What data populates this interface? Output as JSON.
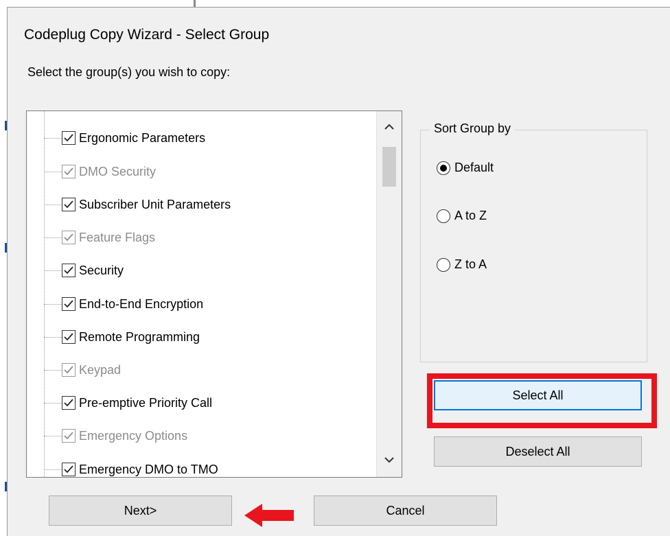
{
  "window": {
    "title": "Codeplug Copy Wizard - Select Group",
    "instruction": "Select the group(s) you wish to copy:"
  },
  "groups": [
    {
      "label": "Ergonomic Parameters",
      "checked": true,
      "enabled": true
    },
    {
      "label": "DMO Security",
      "checked": true,
      "enabled": false
    },
    {
      "label": "Subscriber Unit Parameters",
      "checked": true,
      "enabled": true
    },
    {
      "label": "Feature Flags",
      "checked": true,
      "enabled": false
    },
    {
      "label": "Security",
      "checked": true,
      "enabled": true
    },
    {
      "label": "End-to-End Encryption",
      "checked": true,
      "enabled": true
    },
    {
      "label": "Remote Programming",
      "checked": true,
      "enabled": true
    },
    {
      "label": "Keypad",
      "checked": true,
      "enabled": false
    },
    {
      "label": "Pre-emptive Priority Call",
      "checked": true,
      "enabled": true
    },
    {
      "label": "Emergency Options",
      "checked": true,
      "enabled": false
    },
    {
      "label": "Emergency DMO to TMO",
      "checked": true,
      "enabled": true
    }
  ],
  "sort": {
    "legend": "Sort Group by",
    "options": [
      {
        "label": "Default",
        "selected": true
      },
      {
        "label": "A to Z",
        "selected": false
      },
      {
        "label": "Z to A",
        "selected": false
      }
    ]
  },
  "buttons": {
    "select_all": "Select All",
    "deselect_all": "Deselect All",
    "next": "Next>",
    "cancel": "Cancel"
  },
  "colors": {
    "highlight_box": "#e8151e",
    "arrow": "#e8151e",
    "focus_border": "#0078d7"
  }
}
